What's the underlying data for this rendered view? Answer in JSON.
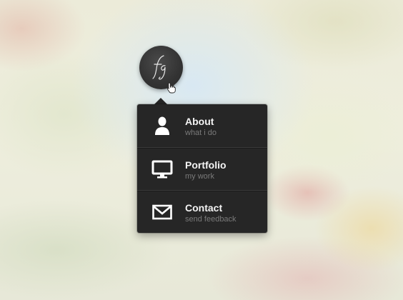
{
  "logo": {
    "monogram": "fg",
    "icon": "monogram-logo-icon"
  },
  "cursor": {
    "icon": "hand-pointer-icon"
  },
  "menu": {
    "items": [
      {
        "label": "About",
        "sublabel": "what i do",
        "icon": "person-icon"
      },
      {
        "label": "Portfolio",
        "sublabel": "my work",
        "icon": "monitor-icon"
      },
      {
        "label": "Contact",
        "sublabel": "send feedback",
        "icon": "envelope-icon"
      }
    ]
  },
  "colors": {
    "menu_background": "#262626",
    "title_text": "#f4f4f4",
    "subtitle_text": "#7a7a7a",
    "icon": "#ffffff"
  }
}
